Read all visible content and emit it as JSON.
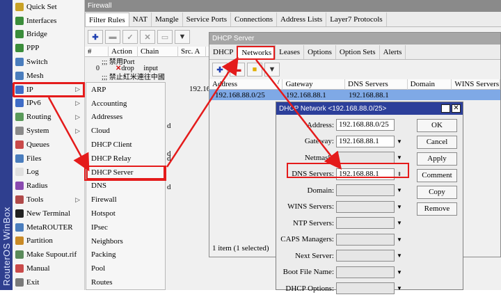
{
  "brand": "RouterOS WinBox",
  "left_menu": [
    {
      "label": "Quick Set",
      "icon": "quick-set-icon",
      "color": "#c9a227"
    },
    {
      "label": "Interfaces",
      "icon": "interfaces-icon",
      "color": "#3b8d3b"
    },
    {
      "label": "Bridge",
      "icon": "bridge-icon",
      "color": "#3b8d3b"
    },
    {
      "label": "PPP",
      "icon": "ppp-icon",
      "color": "#3b8d3b"
    },
    {
      "label": "Switch",
      "icon": "switch-icon",
      "color": "#4a7dbd"
    },
    {
      "label": "Mesh",
      "icon": "mesh-icon",
      "color": "#4a7dbd"
    },
    {
      "label": "IP",
      "icon": "ip-icon",
      "color": "#3f6cc7",
      "arrow": "▷"
    },
    {
      "label": "IPv6",
      "icon": "ipv6-icon",
      "color": "#3f6cc7",
      "arrow": "▷"
    },
    {
      "label": "Routing",
      "icon": "routing-icon",
      "color": "#5a9a5a",
      "arrow": "▷"
    },
    {
      "label": "System",
      "icon": "system-icon",
      "color": "#8a8a8a",
      "arrow": "▷"
    },
    {
      "label": "Queues",
      "icon": "queues-icon",
      "color": "#c94a4a"
    },
    {
      "label": "Files",
      "icon": "files-icon",
      "color": "#4a7dbd"
    },
    {
      "label": "Log",
      "icon": "log-icon",
      "color": "#e0e0e0"
    },
    {
      "label": "Radius",
      "icon": "radius-icon",
      "color": "#8a4ab0"
    },
    {
      "label": "Tools",
      "icon": "tools-icon",
      "color": "#b04a4a",
      "arrow": "▷"
    },
    {
      "label": "New Terminal",
      "icon": "terminal-icon",
      "color": "#222222"
    },
    {
      "label": "MetaROUTER",
      "icon": "metarouter-icon",
      "color": "#4a7dbd"
    },
    {
      "label": "Partition",
      "icon": "partition-icon",
      "color": "#c98a27"
    },
    {
      "label": "Make Supout.rif",
      "icon": "supout-icon",
      "color": "#5a8a5a"
    },
    {
      "label": "Manual",
      "icon": "manual-icon",
      "color": "#c94a4a"
    },
    {
      "label": "Exit",
      "icon": "exit-icon",
      "color": "#7a7a7a"
    }
  ],
  "ip_submenu": [
    "ARP",
    "Accounting",
    "Addresses",
    "Cloud",
    "DHCP Client",
    "DHCP Relay",
    "DHCP Server",
    "DNS",
    "Firewall",
    "Hotspot",
    "IPsec",
    "Neighbors",
    "Packing",
    "Pool",
    "Routes"
  ],
  "firewall": {
    "title": "Firewall",
    "tabs": [
      "Filter Rules",
      "NAT",
      "Mangle",
      "Service Ports",
      "Connections",
      "Address Lists",
      "Layer7 Protocols"
    ],
    "columns": [
      "#",
      "Action",
      "Chain",
      "Src. A"
    ],
    "rows": [
      {
        "num": "",
        "text": ";;; 禁用Port"
      },
      {
        "num": "0",
        "action": "drop",
        "chain": "input"
      },
      {
        "num": "",
        "text": ";;; 禁止紅米連往中國"
      }
    ],
    "partial": "192.16",
    "peek": [
      "d",
      "d",
      "d",
      "d"
    ]
  },
  "dhcp": {
    "title": "DHCP Server",
    "tabs": [
      "DHCP",
      "Networks",
      "Leases",
      "Options",
      "Option Sets",
      "Alerts"
    ],
    "columns": [
      "Address",
      "Gateway",
      "DNS Servers",
      "Domain",
      "WINS Servers"
    ],
    "row": {
      "address": "192.168.88.0/25",
      "gateway": "192.168.88.1",
      "dns": "192.168.88.1"
    },
    "status": "1 item (1 selected)",
    "sort_mark": "/"
  },
  "net": {
    "title": "DHCP Network <192.168.88.0/25>",
    "fields": [
      {
        "label": "Address:",
        "value": "192.168.88.0/25",
        "empty": false,
        "btn": ""
      },
      {
        "label": "Gateway:",
        "value": "192.168.88.1",
        "empty": false,
        "btn": "▼"
      },
      {
        "label": "Netmask:",
        "value": "",
        "empty": true,
        "btn": "▼"
      },
      {
        "label": "DNS Servers:",
        "value": "192.168.88.1",
        "empty": false,
        "btn": "⇕"
      },
      {
        "label": "Domain:",
        "value": "",
        "empty": true,
        "btn": "▼"
      },
      {
        "label": "WINS Servers:",
        "value": "",
        "empty": true,
        "btn": "▼"
      },
      {
        "label": "NTP Servers:",
        "value": "",
        "empty": true,
        "btn": "▼"
      },
      {
        "label": "CAPS Managers:",
        "value": "",
        "empty": true,
        "btn": "▼"
      },
      {
        "label": "Next Server:",
        "value": "",
        "empty": true,
        "btn": "▼"
      },
      {
        "label": "Boot File Name:",
        "value": "",
        "empty": true,
        "btn": "▼"
      },
      {
        "label": "DHCP Options:",
        "value": "",
        "empty": true,
        "btn": "▼"
      }
    ],
    "buttons": [
      "OK",
      "Cancel",
      "Apply",
      "Comment",
      "Copy",
      "Remove"
    ]
  }
}
